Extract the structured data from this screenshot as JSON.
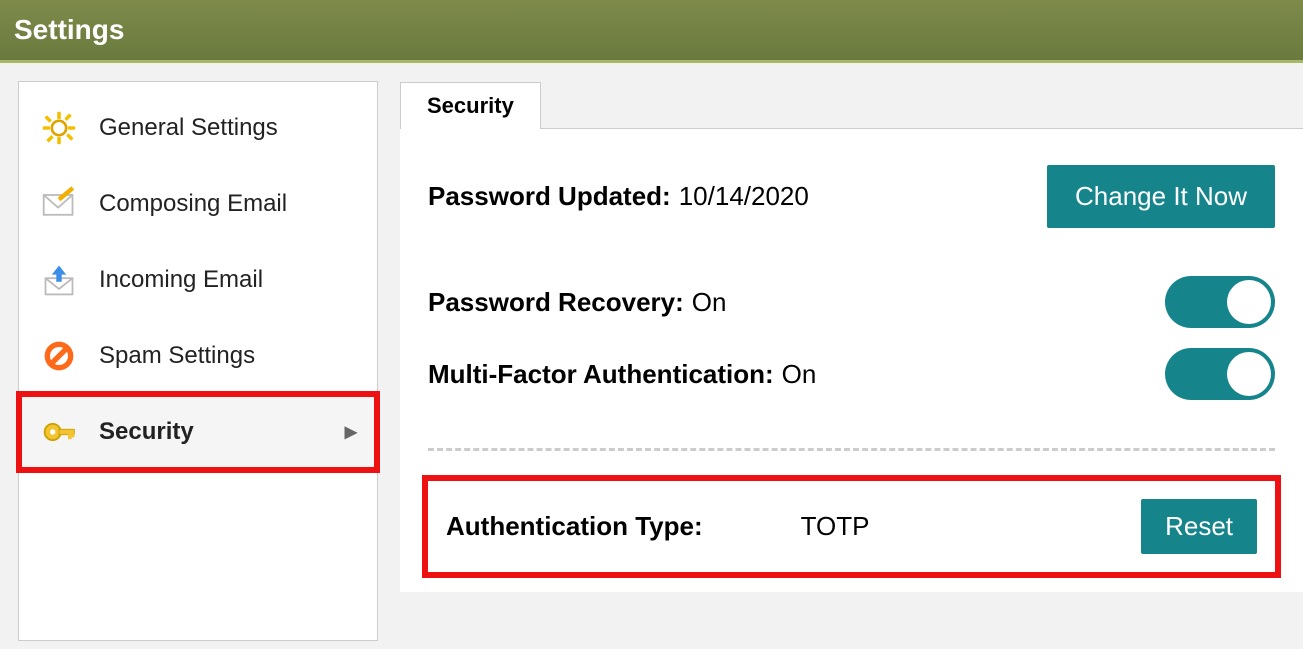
{
  "header": {
    "title": "Settings"
  },
  "sidebar": {
    "items": [
      {
        "label": "General Settings"
      },
      {
        "label": "Composing Email"
      },
      {
        "label": "Incoming Email"
      },
      {
        "label": "Spam Settings"
      },
      {
        "label": "Security"
      }
    ]
  },
  "main": {
    "tab_label": "Security",
    "password_updated_label": "Password Updated:",
    "password_updated_value": "10/14/2020",
    "change_button": "Change It Now",
    "password_recovery_label": "Password Recovery:",
    "password_recovery_value": "On",
    "mfa_label": "Multi-Factor Authentication:",
    "mfa_value": "On",
    "auth_type_label": "Authentication Type:",
    "auth_type_value": "TOTP",
    "reset_button": "Reset"
  }
}
